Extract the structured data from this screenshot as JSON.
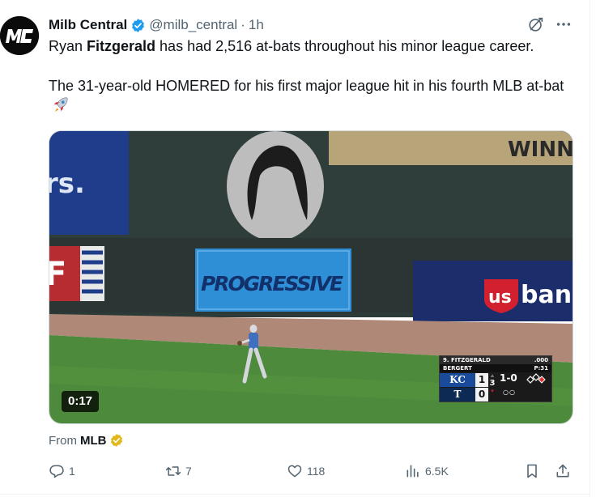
{
  "author": {
    "display_name": "Milb Central",
    "handle": "@milb_central",
    "separator": "·",
    "time": "1h",
    "avatar_text": "MC"
  },
  "tweet": {
    "line1_before": "Ryan ",
    "line1_bold": "Fitzgerald",
    "line1_after": " has had 2,516 at-bats throughout his minor league career.",
    "paragraph2": "The 31-year-old HOMERED for his first major league hit in his fourth MLB at-bat"
  },
  "media": {
    "duration": "0:17",
    "signs": {
      "left_fragment": "rs.",
      "progressive": "PROGRESSIVE",
      "top_right": "WINN",
      "bank": "bank",
      "bank_us": "us",
      "flag_letter": "F"
    },
    "scorebug": {
      "batter": "9. FITZGERALD",
      "avg": ".000",
      "pitcher": "BERGERT",
      "pitch_count": "P:31",
      "away_team": "KC",
      "away_score": "1",
      "home_team": "T",
      "home_score": "0",
      "inning": "3",
      "count": "1-0",
      "outs": "○○"
    }
  },
  "source": {
    "from_label": "From",
    "from_name": "MLB"
  },
  "actions": {
    "replies": "1",
    "reposts": "7",
    "likes": "118",
    "views": "6.5K"
  },
  "colors": {
    "accent": "#1d9bf0",
    "text_secondary": "#536471",
    "gold_badge": "#e2b719",
    "progressive_blue": "#2e8fd6"
  }
}
